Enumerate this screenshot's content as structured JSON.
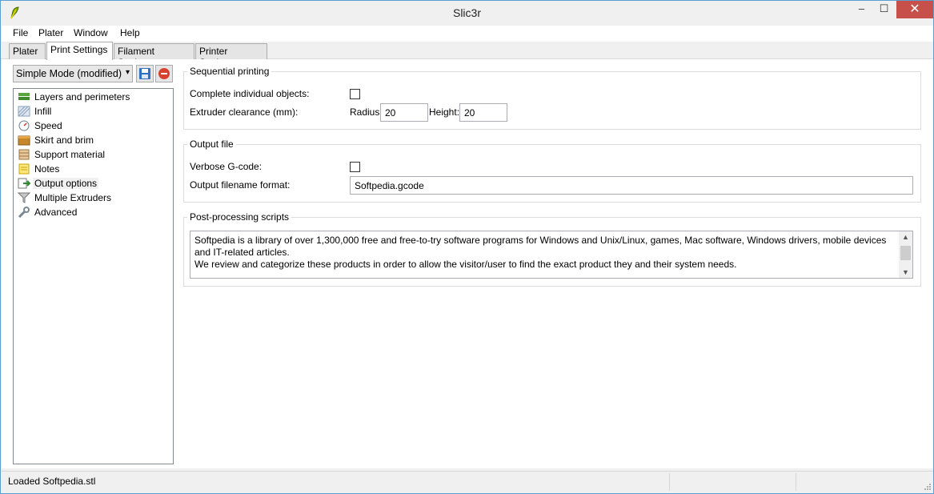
{
  "window": {
    "title": "Slic3r",
    "minimize_glyph": "–",
    "maximize_glyph": "☐",
    "close_glyph": "✕"
  },
  "menu": {
    "items": [
      "File",
      "Plater",
      "Window",
      "Help"
    ]
  },
  "tabs": [
    {
      "label": "Plater",
      "active": false
    },
    {
      "label": "Print Settings",
      "active": true
    },
    {
      "label": "Filament Settings",
      "active": false
    },
    {
      "label": "Printer Settings",
      "active": false
    }
  ],
  "preset": {
    "selected": "Simple Mode (modified)",
    "dropdown_arrow": "▾",
    "save_icon": "save-icon",
    "delete_icon": "delete-icon"
  },
  "tree": {
    "items": [
      {
        "label": "Layers and perimeters",
        "icon": "layers-icon"
      },
      {
        "label": "Infill",
        "icon": "infill-icon"
      },
      {
        "label": "Speed",
        "icon": "speed-icon"
      },
      {
        "label": "Skirt and brim",
        "icon": "skirt-icon"
      },
      {
        "label": "Support material",
        "icon": "support-icon"
      },
      {
        "label": "Notes",
        "icon": "notes-icon"
      },
      {
        "label": "Output options",
        "icon": "output-icon",
        "selected": true
      },
      {
        "label": "Multiple Extruders",
        "icon": "funnel-icon"
      },
      {
        "label": "Advanced",
        "icon": "wrench-icon"
      }
    ]
  },
  "sequential": {
    "title": "Sequential printing",
    "complete_label": "Complete individual objects:",
    "complete_checked": false,
    "clearance_label": "Extruder clearance (mm):",
    "radius_label": "Radius:",
    "radius_value": "20",
    "height_label": "Height:",
    "height_value": "20"
  },
  "output": {
    "title": "Output file",
    "verbose_label": "Verbose G-code:",
    "verbose_checked": false,
    "filename_label": "Output filename format:",
    "filename_value": "Softpedia.gcode"
  },
  "post": {
    "title": "Post-processing scripts",
    "text_line1": "Softpedia is a library of over 1,300,000 free and free-to-try software programs for Windows and Unix/Linux, games, Mac software, Windows drivers, mobile devices and IT-related articles.",
    "text_line2": "We review and categorize these products in order to allow the visitor/user to find the exact product they and their system needs.",
    "scroll_up": "▲",
    "scroll_down": "▼"
  },
  "status": {
    "text": "Loaded Softpedia.stl"
  },
  "colors": {
    "accent": "#5a9fd4",
    "close_button": "#c7504b",
    "save_blue": "#2f6fc4",
    "delete_red": "#d9412f"
  }
}
